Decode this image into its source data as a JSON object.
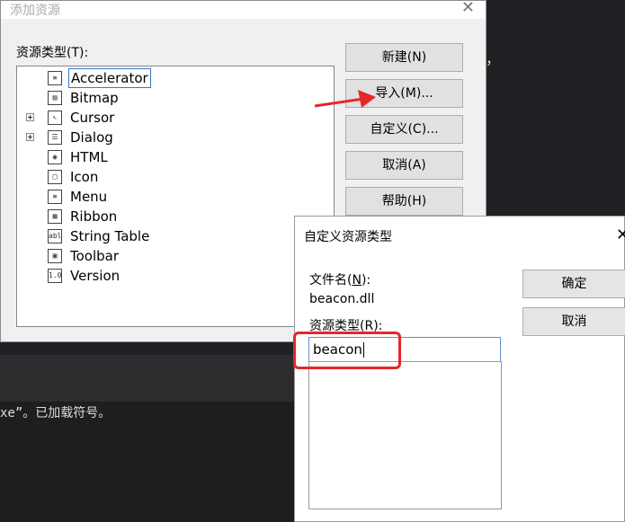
{
  "background": {
    "console_text": "xe”。已加载符号。",
    "stray_char": "，"
  },
  "add_resource_dialog": {
    "title": "添加资源",
    "close": "✕",
    "resource_type_label": "资源类型(T):",
    "tree": [
      {
        "label": "Accelerator",
        "icon": "accelerator-icon",
        "glyph": "≡",
        "expandable": false,
        "selected": true
      },
      {
        "label": "Bitmap",
        "icon": "bitmap-icon",
        "glyph": "▨",
        "expandable": false
      },
      {
        "label": "Cursor",
        "icon": "cursor-icon",
        "glyph": "↖",
        "expandable": true
      },
      {
        "label": "Dialog",
        "icon": "dialog-icon",
        "glyph": "☰",
        "expandable": true
      },
      {
        "label": "HTML",
        "icon": "html-icon",
        "glyph": "◉",
        "expandable": false
      },
      {
        "label": "Icon",
        "icon": "icon-resource-icon",
        "glyph": "□",
        "expandable": false
      },
      {
        "label": "Menu",
        "icon": "menu-icon",
        "glyph": "≡",
        "expandable": false
      },
      {
        "label": "Ribbon",
        "icon": "ribbon-icon",
        "glyph": "▦",
        "expandable": false
      },
      {
        "label": "String Table",
        "icon": "string-table-icon",
        "glyph": "abl",
        "expandable": false
      },
      {
        "label": "Toolbar",
        "icon": "toolbar-icon",
        "glyph": "▣",
        "expandable": false
      },
      {
        "label": "Version",
        "icon": "version-icon",
        "glyph": "1.0",
        "expandable": false
      }
    ],
    "buttons": {
      "new": "新建(N)",
      "import": "导入(M)...",
      "custom": "自定义(C)...",
      "cancel": "取消(A)",
      "help": "帮助(H)"
    }
  },
  "custom_type_dialog": {
    "title": "自定义资源类型",
    "close": "✕",
    "filename_label_pre": "文件名(",
    "filename_label_key": "N",
    "filename_label_post": "):",
    "filename_value": "beacon.dll",
    "type_label": "资源类型(R):",
    "type_value": "beacon",
    "ok": "确定",
    "cancel": "取消"
  },
  "annotation_color": "#e8262a"
}
